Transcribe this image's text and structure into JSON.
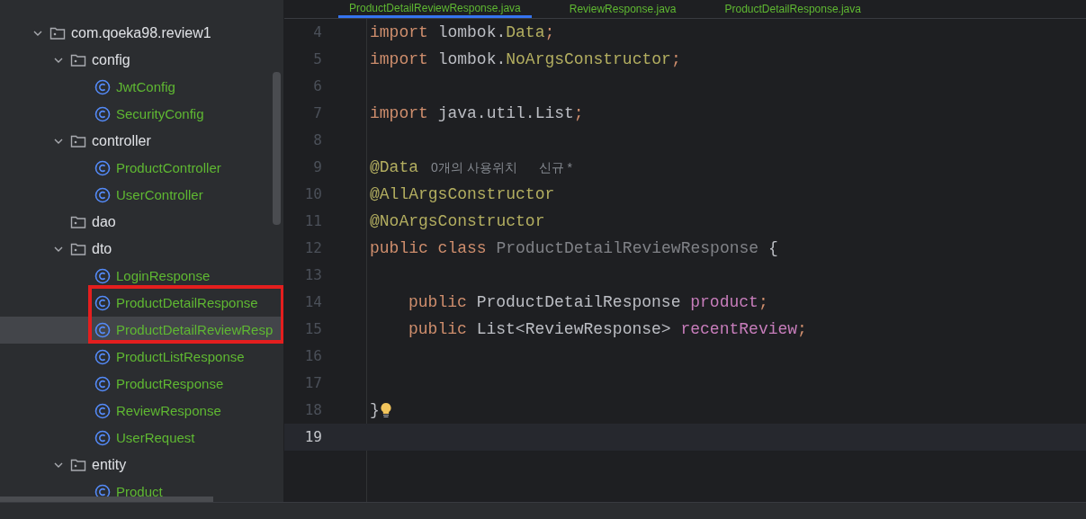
{
  "tabs": [
    {
      "label": "ProductDetailReviewResponse.java",
      "selected": true
    },
    {
      "label": "ReviewResponse.java",
      "selected": false
    },
    {
      "label": "ProductDetailResponse.java",
      "selected": false
    }
  ],
  "project_tree": [
    {
      "label": "com.qoeka98.review1",
      "kind": "package",
      "expanded": true,
      "children": [
        {
          "label": "config",
          "kind": "package",
          "expanded": true,
          "children": [
            {
              "label": "JwtConfig",
              "kind": "class",
              "selected": false
            },
            {
              "label": "SecurityConfig",
              "kind": "class",
              "selected": false
            }
          ]
        },
        {
          "label": "controller",
          "kind": "package",
          "expanded": true,
          "children": [
            {
              "label": "ProductController",
              "kind": "class",
              "selected": false
            },
            {
              "label": "UserController",
              "kind": "class",
              "selected": false
            }
          ]
        },
        {
          "label": "dao",
          "kind": "package",
          "expanded": false
        },
        {
          "label": "dto",
          "kind": "package",
          "expanded": true,
          "children": [
            {
              "label": "LoginResponse",
              "kind": "class",
              "selected": false
            },
            {
              "label": "ProductDetailResponse",
              "kind": "class",
              "selected": false
            },
            {
              "label": "ProductDetailReviewResp",
              "kind": "class",
              "selected": true,
              "marked": true
            },
            {
              "label": "ProductListResponse",
              "kind": "class",
              "selected": false
            },
            {
              "label": "ProductResponse",
              "kind": "class",
              "selected": false
            },
            {
              "label": "ReviewResponse",
              "kind": "class",
              "selected": false
            },
            {
              "label": "UserRequest",
              "kind": "class",
              "selected": false
            }
          ]
        },
        {
          "label": "entity",
          "kind": "package",
          "expanded": true,
          "children": [
            {
              "label": "Product",
              "kind": "class",
              "selected": false
            }
          ]
        }
      ]
    }
  ],
  "editor": {
    "lines": [
      {
        "number": "4",
        "current": false,
        "tokens": [
          {
            "kind": "keyword",
            "text": "import "
          },
          {
            "kind": "plain",
            "text": "lombok."
          },
          {
            "kind": "annotation",
            "text": "Data"
          },
          {
            "kind": "punct",
            "text": ";"
          }
        ]
      },
      {
        "number": "5",
        "current": false,
        "tokens": [
          {
            "kind": "keyword",
            "text": "import "
          },
          {
            "kind": "plain",
            "text": "lombok."
          },
          {
            "kind": "annotation",
            "text": "NoArgsConstructor"
          },
          {
            "kind": "punct",
            "text": ";"
          }
        ]
      },
      {
        "number": "6",
        "current": false
      },
      {
        "number": "7",
        "current": false,
        "tokens": [
          {
            "kind": "keyword",
            "text": "import "
          },
          {
            "kind": "plain",
            "text": "java.util.List"
          },
          {
            "kind": "punct",
            "text": ";"
          }
        ]
      },
      {
        "number": "8",
        "current": false
      },
      {
        "number": "9",
        "current": false,
        "tokens": [
          {
            "kind": "annotation",
            "text": "@Data"
          },
          {
            "kind": "hint",
            "text": "0개의 사용위치"
          },
          {
            "kind": "hint",
            "text": "신규 *"
          }
        ]
      },
      {
        "number": "10",
        "current": false,
        "tokens": [
          {
            "kind": "annotation",
            "text": "@AllArgsConstructor"
          }
        ]
      },
      {
        "number": "11",
        "current": false,
        "tokens": [
          {
            "kind": "annotation",
            "text": "@NoArgsConstructor"
          }
        ]
      },
      {
        "number": "12",
        "current": false,
        "tokens": [
          {
            "kind": "keyword",
            "text": "public class "
          },
          {
            "kind": "unused",
            "text": "ProductDetailReviewResponse "
          },
          {
            "kind": "plain",
            "text": "{"
          }
        ]
      },
      {
        "number": "13",
        "current": false
      },
      {
        "number": "14",
        "current": false,
        "indented": true,
        "tokens": [
          {
            "kind": "keyword",
            "text": "public "
          },
          {
            "kind": "plain",
            "text": "ProductDetailResponse "
          },
          {
            "kind": "field",
            "text": "product"
          },
          {
            "kind": "punct",
            "text": ";"
          }
        ]
      },
      {
        "number": "15",
        "current": false,
        "indented": true,
        "tokens": [
          {
            "kind": "keyword",
            "text": "public "
          },
          {
            "kind": "plain",
            "text": "List<ReviewResponse> "
          },
          {
            "kind": "field",
            "text": "recentReview"
          },
          {
            "kind": "punct",
            "text": ";"
          }
        ]
      },
      {
        "number": "16",
        "current": false
      },
      {
        "number": "17",
        "current": false
      },
      {
        "number": "18",
        "current": false,
        "tokens": [
          {
            "kind": "plain",
            "text": "}"
          },
          {
            "kind": "bulb"
          }
        ]
      },
      {
        "number": "19",
        "current": true
      }
    ]
  }
}
